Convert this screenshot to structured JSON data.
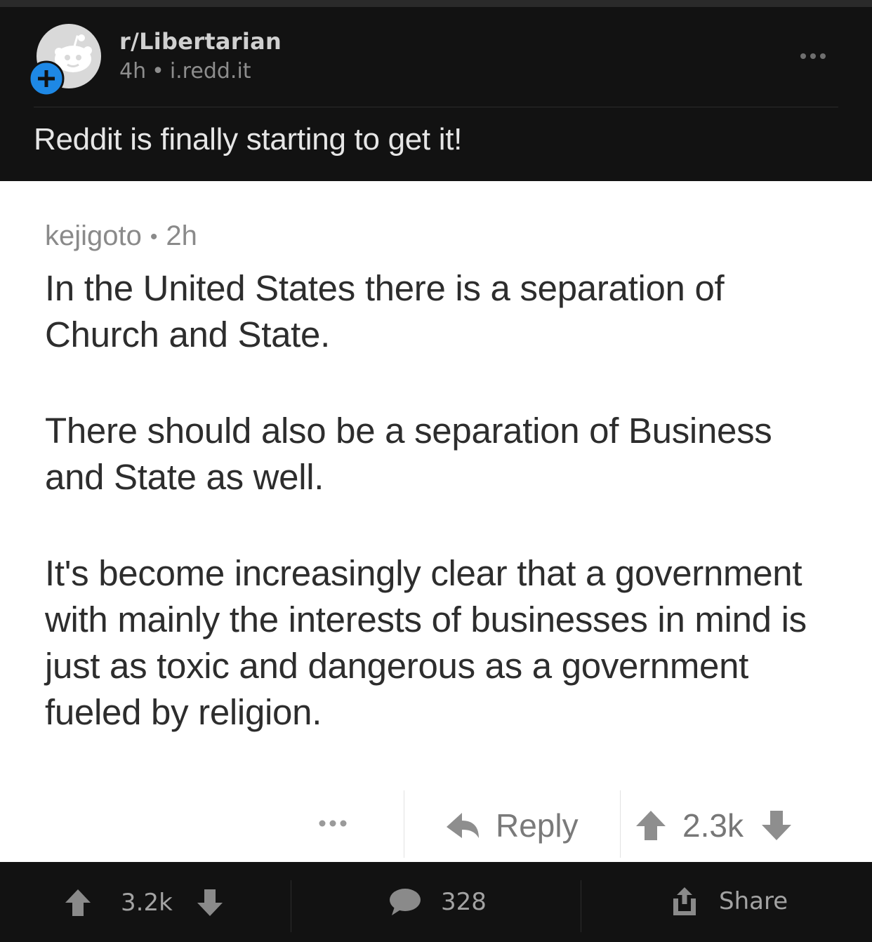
{
  "post": {
    "subreddit": "r/Libertarian",
    "age": "4h",
    "separator": "•",
    "domain": "i.redd.it",
    "title": "Reddit is finally starting to get it!",
    "menu_icon": "more-dots-icon",
    "avatar_icon": "reddit-snoo-icon",
    "join_icon": "plus-circle-icon",
    "join_color": "#1e88e5"
  },
  "comment": {
    "author": "kejigoto",
    "separator": "•",
    "age": "2h",
    "paragraphs": [
      "In the United States there is a separation of Church and State.",
      "There should also be a separation of Business and State as well.",
      "It's become increasingly clear that a government with mainly the interests of businesses in mind is just as toxic and dangerous as a government fueled by religion."
    ],
    "reply_label": "Reply",
    "score": "2.3k",
    "more_icon": "more-dots-icon",
    "reply_icon": "reply-arrow-icon"
  },
  "footer": {
    "score": "3.2k",
    "comment_count": "328",
    "share_label": "Share",
    "upvote_icon": "upvote-arrow-icon",
    "downvote_icon": "downvote-arrow-icon",
    "comment_icon": "speech-bubble-icon",
    "share_icon": "share-icon"
  }
}
